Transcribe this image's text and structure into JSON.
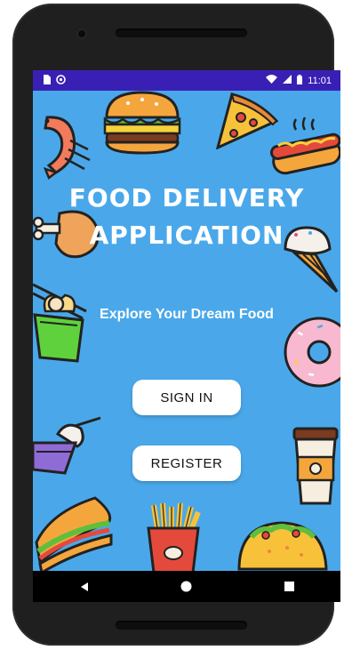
{
  "status_bar": {
    "time": "11:01",
    "icons": [
      "sim-card-icon",
      "sync-icon",
      "wifi-icon",
      "signal-icon",
      "battery-icon"
    ]
  },
  "app": {
    "title_line1": "FOOD DELIVERY",
    "title_line2": "APPLICATION",
    "tagline": "Explore Your Dream Food"
  },
  "buttons": {
    "sign_in": "SIGN IN",
    "register": "REGISTER"
  },
  "navigation": {
    "icons": [
      "back-icon",
      "home-icon",
      "recent-apps-icon"
    ]
  },
  "colors": {
    "background": "#4aa8ea",
    "status_bar": "#3a1fb5",
    "nav_bar": "#000000",
    "button": "#ffffff"
  },
  "doodles": [
    "burger-icon",
    "pizza-slice-icon",
    "shrimp-icon",
    "hotdog-icon",
    "chicken-leg-icon",
    "ice-cream-cone-icon",
    "noodle-box-icon",
    "donut-icon",
    "milkshake-icon",
    "coffee-cup-icon",
    "sandwich-icon",
    "french-fries-icon",
    "taco-icon"
  ]
}
